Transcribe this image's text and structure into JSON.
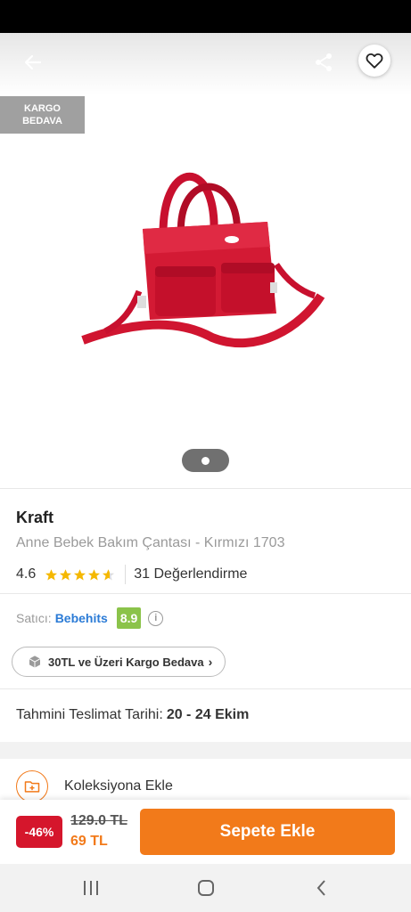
{
  "header": {
    "back_icon": "arrow-left-icon",
    "share_icon": "share-icon",
    "favorite_icon": "heart-icon"
  },
  "image": {
    "badge_line1": "KARGO",
    "badge_line2": "BEDAVA",
    "product_image": "red quilted baby care bag"
  },
  "product": {
    "brand": "Kraft",
    "name": "Anne Bebek Bakım Çantası - Kırmızı 1703",
    "rating": "4.6",
    "review_count": "31 Değerlendirme"
  },
  "seller": {
    "label": "Satıcı:",
    "name": "Bebehits",
    "score": "8.9"
  },
  "cargo": {
    "text": "30TL ve Üzeri Kargo Bedava"
  },
  "delivery": {
    "label": "Tahmini Teslimat Tarihi:",
    "dates": "20 - 24 Ekim"
  },
  "collection": {
    "label": "Koleksiyona Ekle"
  },
  "purchase": {
    "discount": "-46%",
    "old_price": "129.0 TL",
    "new_price": "69 TL",
    "add_to_cart": "Sepete Ekle"
  },
  "colors": {
    "accent": "#f27a1a",
    "discount": "#d5162c",
    "seller_link": "#2b7bd6",
    "score_badge": "#8bc34a"
  }
}
